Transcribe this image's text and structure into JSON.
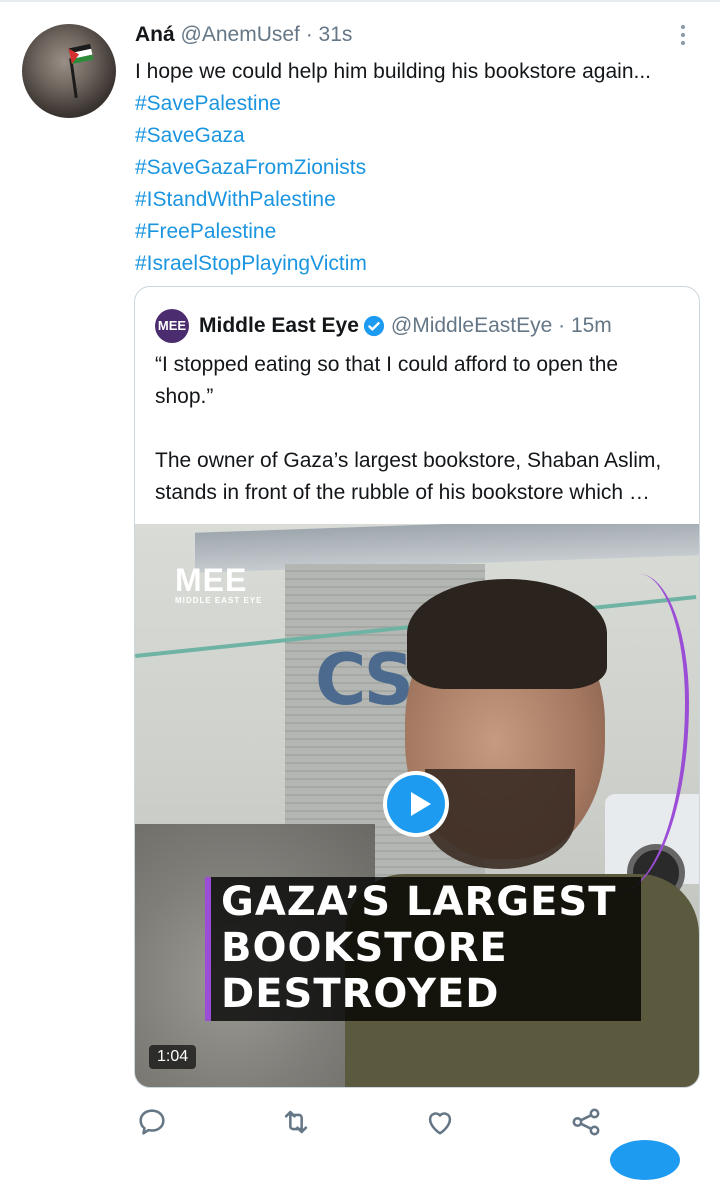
{
  "tweet": {
    "author_name": "Aná",
    "handle_time": "@AnemUsef · 31s",
    "text": "I hope we could help him building his bookstore again...",
    "hashtags": [
      "#SavePalestine",
      "#SaveGaza",
      "#SaveGazaFromZionists",
      "#IStandWithPalestine",
      "#FreePalestine",
      "#IsraelStopPlayingVictim"
    ]
  },
  "quoted": {
    "logo_text": "MEE",
    "name": "Middle East Eye",
    "handle_time": "@MiddleEastEye · 15m",
    "paragraph1": "“I stopped eating so that I could afford to open the shop.”",
    "paragraph2": "The owner of Gaza’s largest bookstore, Shaban Aslim, stands in front of the rubble of his bookstore which …",
    "media": {
      "brand_big": "MEE",
      "brand_small": "MIDDLE EAST EYE",
      "caption_lines": [
        "GAZA’S LARGEST",
        "BOOKSTORE",
        "DESTROYED"
      ],
      "duration": "1:04"
    }
  },
  "icons": {
    "reply": "speech-bubble-icon",
    "retweet": "retweet-icon",
    "like": "heart-icon",
    "share": "share-icon",
    "more": "vertical-dots-icon",
    "verified": "verified-badge-icon",
    "play": "play-icon"
  },
  "colors": {
    "hashtag": "#1b95e0",
    "muted": "#657786",
    "verified": "#1d9bf0",
    "mee_purple": "#9b4dd6"
  }
}
